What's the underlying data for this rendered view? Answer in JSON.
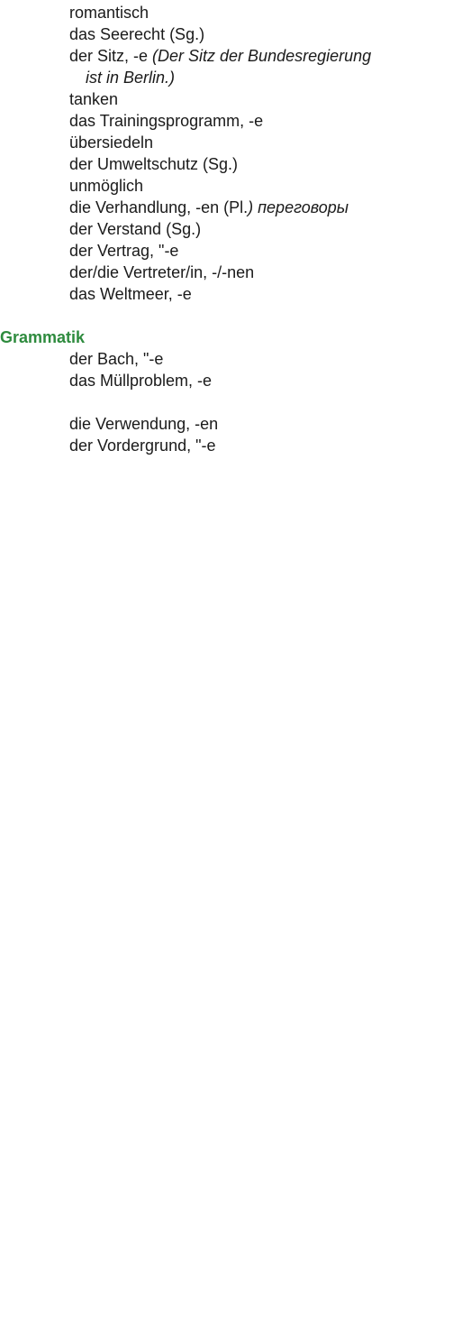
{
  "vocab_list": [
    {
      "main": "romantisch"
    },
    {
      "main": "das Seerecht (Sg.)"
    },
    {
      "main": "der Sitz, -e ",
      "italic": "(Der Sitz der Bundesregierung",
      "continuation": "ist in Berlin.)"
    },
    {
      "main": "tanken"
    },
    {
      "main": "das Trainingsprogramm, -e"
    },
    {
      "main": "übersiedeln"
    },
    {
      "main": "der Umweltschutz (Sg.)"
    },
    {
      "main": "unmöglich"
    },
    {
      "main": "die Verhandlung, -en (Pl.",
      "italic": ") переговоры"
    },
    {
      "main": "der Verstand (Sg.)"
    },
    {
      "main": "der Vertrag, \"-e"
    },
    {
      "main": "der/die Vertreter/in, -/-nen"
    },
    {
      "main": "das Weltmeer, -e"
    }
  ],
  "grammatik": {
    "heading": "Grammatik",
    "items": [
      "der Bach, \"-e",
      "das Müllproblem, -e",
      "die Verwendung, -en",
      "der Vordergrund, \"-e"
    ]
  },
  "colors": {
    "heading": "#2e8b3e",
    "text": "#1a1a1a"
  }
}
